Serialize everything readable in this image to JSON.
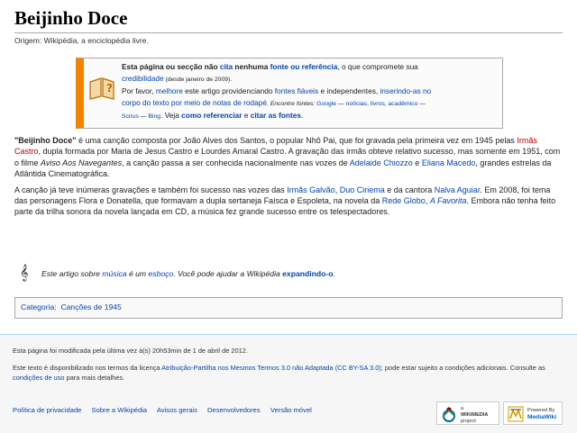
{
  "page": {
    "title": "Beijinho Doce",
    "origin": "Origem: Wikipédia, a enciclopédia livre."
  },
  "ambox": {
    "l1_a": "Esta página ou secção não ",
    "l1_cita": "cita",
    "l1_b": " nenhuma ",
    "l1_fonte": "fonte ou referência",
    "l1_c": ", o que compromete sua",
    "l2_cred": "credibilidade",
    "l2_date": " (desde janeiro de 2009).",
    "l3_a": "Por favor, ",
    "l3_melhore": "melhore",
    "l3_b": " este artigo providenciando ",
    "l3_fontes": "fontes fiáveis",
    "l3_c": " e independentes, ",
    "l3_inserindo": "inserindo-as no",
    "l4_corpo": "corpo do texto por meio de notas de rodapé",
    "l4_enc": ". Encontre fontes: ",
    "l4_google": "Google",
    "l4_sep1": " — ",
    "l4_noticias": "notícias",
    "l4_sep2": ", ",
    "l4_livros": "livros",
    "l4_sep3": ", ",
    "l4_academico": "acadêmico",
    "l4_sep4": " —",
    "l5_scirus": "Scirus",
    "l5_sep": " — ",
    "l5_bing": "Bing",
    "l5_veja": ". Veja ",
    "l5_como": "como referenciar",
    "l5_e": " e ",
    "l5_citar": "citar as fontes",
    "l5_end": "."
  },
  "article": {
    "p1_bold": "\"Beijinho Doce\"",
    "p1_a": " é uma canção composta por João Alves dos Santos, o popular Nhô Pai, que foi gravada pela primeira vez em 1945 pelas ",
    "p1_irmas": "Irmãs Castro",
    "p1_b": ", dupla formada por Maria de Jesus Castro e Lourdes Amaral Castro. A gravação das irmãs obteve relativo sucesso, mas somente em 1951, com o filme ",
    "p1_film": "Aviso Aos Navegantes",
    "p1_c": ", a canção passa a ser conhecida nacionalmente nas vozes de ",
    "p1_adelaide": "Adelaide Chiozzo",
    "p1_d": " e ",
    "p1_eliana": "Eliana Macedo",
    "p1_e": ", grandes estrelas da Atlântida Cinematográfica.",
    "p2_a": "A canção já teve inúmeras gravações e também foi sucesso nas vozes das ",
    "p2_galvao": "Irmãs Galvão",
    "p2_sep": ", ",
    "p2_duo": "Duo Ciriema",
    "p2_b": " e da cantora ",
    "p2_nalva": "Nalva Aguiar",
    "p2_c": ". Em 2008, foi tema das personagens Flora e Donatella, que formavam a dupla sertaneja Faísca e Espoleta, na novela da ",
    "p2_globo": "Rede Globo",
    "p2_d": ", ",
    "p2_favorita": "A Favorita",
    "p2_e": ". Embora não tenha feito parte da trilha sonora da novela lançada em CD, a música fez grande sucesso entre os telespectadores."
  },
  "stub": {
    "a": "Este artigo sobre ",
    "musica": "música",
    "b": " é um ",
    "esboco": "esboço",
    "c": ". Você pode ajudar a Wikipédia ",
    "expandindo": "expandindo-o",
    "d": "."
  },
  "catlinks": {
    "label": "Categoria",
    "colon": ":",
    "item": "Canções de 1945"
  },
  "footer": {
    "modified": "Esta página foi modificada pela última vez à(s) 20h53min de 1 de abril de 2012.",
    "license_a": "Este texto é disponibilizado nos termos da licença ",
    "license_link": "Atribuição-Partilha nos Mesmos Termos 3.0 não Adaptada (CC BY-SA 3.0)",
    "license_b": "; pode estar sujeito a condições adicionais. Consulte as ",
    "license_cond": "condições de uso",
    "license_c": " para mais detalhes.",
    "links": [
      "Política de privacidade",
      "Sobre a Wikipédia",
      "Avisos gerais",
      "Desenvolvedores",
      "Versão móvel"
    ]
  },
  "badges": {
    "wmf_line1": "a",
    "wmf_line2": "WIKIMEDIA",
    "wmf_line3": "project",
    "mw_line1": "Powered By",
    "mw_line2": "MediaWiki"
  },
  "colors": {
    "link": "#0645ad",
    "new_link": "#ba0000",
    "ambox_accent": "#f28500"
  }
}
